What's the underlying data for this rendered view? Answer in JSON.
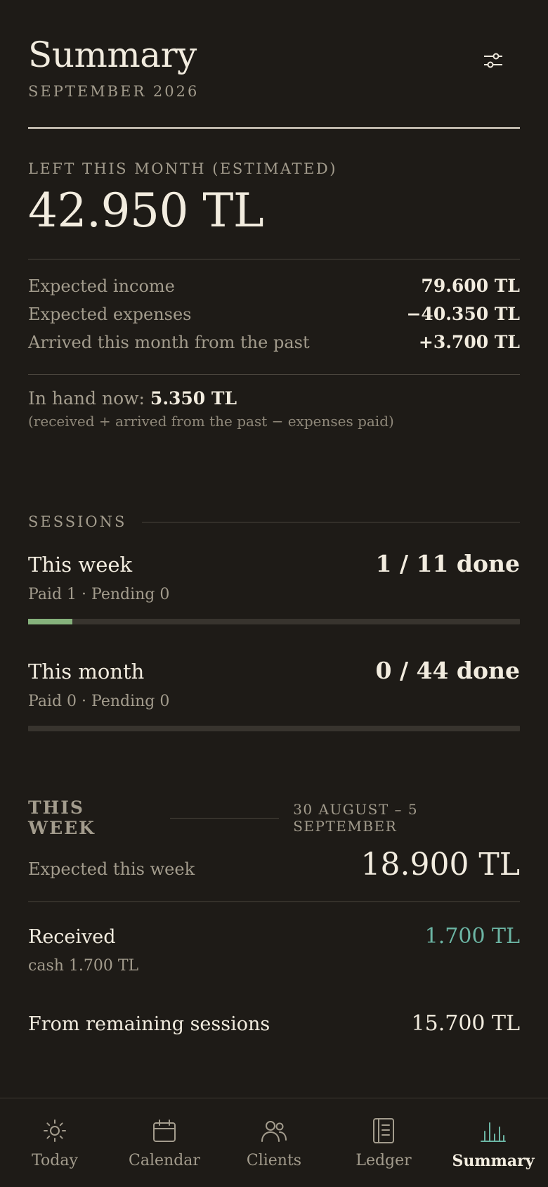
{
  "header": {
    "title": "Summary",
    "subtitle": "SEPTEMBER 2026",
    "filter_icon": "sliders-icon"
  },
  "left_this_month": {
    "label": "LEFT THIS MONTH (ESTIMATED)",
    "amount": "42.950 TL"
  },
  "breakdown": [
    {
      "label": "Expected income",
      "value": "79.600 TL"
    },
    {
      "label": "Expected expenses",
      "value": "−40.350 TL"
    },
    {
      "label": "Arrived this month from the past",
      "value": "+3.700 TL"
    }
  ],
  "in_hand": {
    "label": "In hand now:",
    "value": "5.350 TL",
    "note": "(received + arrived from the past − expenses paid)"
  },
  "sessions": {
    "heading": "SESSIONS",
    "week": {
      "name": "This week",
      "count": "1 / 11 done",
      "sub": "Paid 1 · Pending 0",
      "progress": 0.09
    },
    "month": {
      "name": "This month",
      "count": "0 / 44 done",
      "sub": "Paid 0 · Pending 0",
      "progress": 0
    }
  },
  "this_week": {
    "heading": "THIS WEEK",
    "range": "30 AUGUST – 5 SEPTEMBER",
    "expected_label": "Expected this week",
    "expected_value": "18.900 TL",
    "received_label": "Received",
    "received_value": "1.700 TL",
    "received_sub": "cash 1.700 TL",
    "remaining_label": "From remaining sessions",
    "remaining_value": "15.700 TL"
  },
  "tabs": [
    {
      "label": "Today",
      "icon": "sun-icon",
      "active": false
    },
    {
      "label": "Calendar",
      "icon": "calendar-icon",
      "active": false
    },
    {
      "label": "Clients",
      "icon": "users-icon",
      "active": false
    },
    {
      "label": "Ledger",
      "icon": "ledger-icon",
      "active": false
    },
    {
      "label": "Summary",
      "icon": "bar-chart-icon",
      "active": true
    }
  ],
  "colors": {
    "background": "#1e1b17",
    "accent_green": "#86b27c",
    "accent_teal": "#6cb5a4"
  }
}
